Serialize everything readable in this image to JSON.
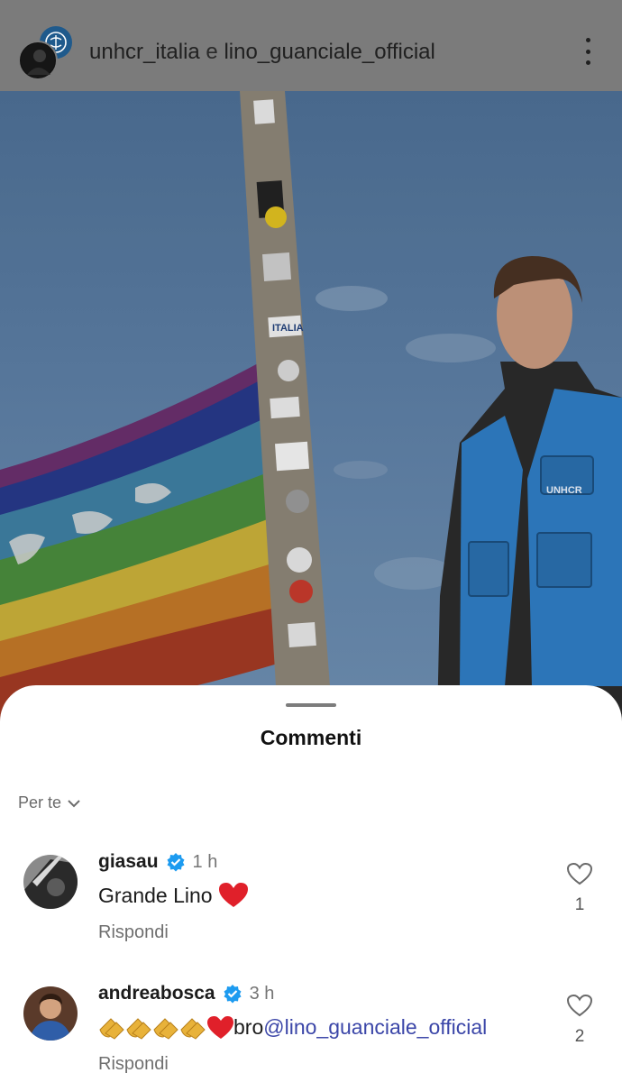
{
  "header": {
    "user1": "unhcr_italia",
    "connector": " e ",
    "user2": "lino_guanciale_official"
  },
  "photo": {
    "description_icons": [
      "flag",
      "pole",
      "person"
    ],
    "badge_text": "UNHCR",
    "sticker_text": "ITALIA"
  },
  "sheet": {
    "title": "Commenti",
    "filter_label": "Per te"
  },
  "comments": [
    {
      "username": "giasau",
      "verified": true,
      "time": "1 h",
      "text": "Grande Lino",
      "emoji": "heart",
      "reply_label": "Rispondi",
      "likes": "1"
    },
    {
      "username": "andreabosca",
      "verified": true,
      "time": "3 h",
      "text": "bro ",
      "mention": "@lino_guanciale_official",
      "emoji": "clap-x4-heart",
      "reply_label": "Rispondi",
      "likes": "2"
    }
  ],
  "colors": {
    "header_bg": "#7b7b7b",
    "verified": "#1d9bf0",
    "mention": "#3b46a8"
  }
}
